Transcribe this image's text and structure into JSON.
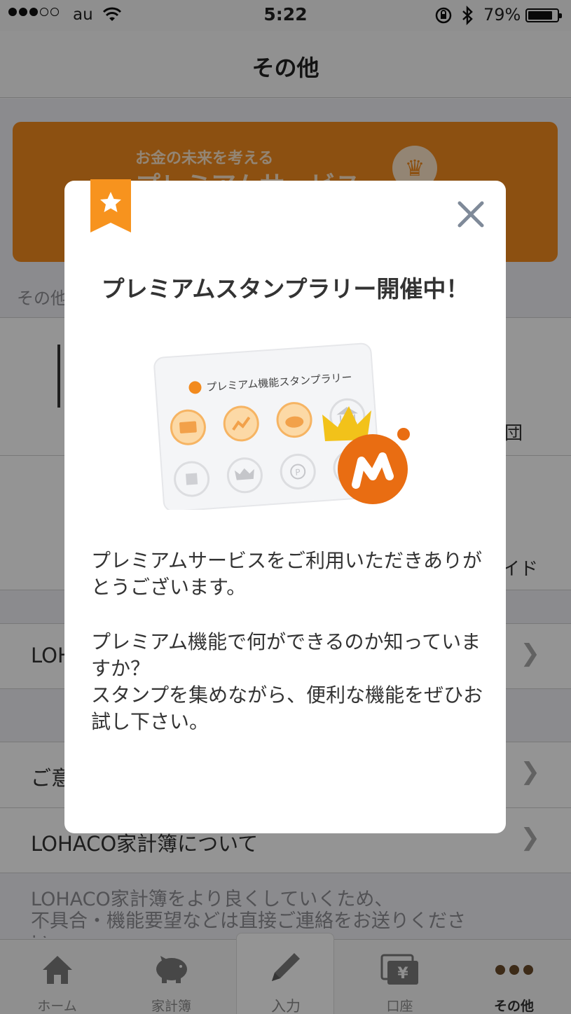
{
  "status_bar": {
    "carrier": "au",
    "time": "5:22",
    "battery": "79%"
  },
  "nav": {
    "title": "その他"
  },
  "banner": {
    "small_text": "お金の未来を考える",
    "big_text": "プレミアムサービス"
  },
  "background": {
    "section_label": "その他",
    "peek_dan": "団",
    "peek_ido": "イド",
    "row_lohaco_peek": "LOH",
    "row_feedback_peek": "ご意",
    "row_about": "LOHACO家計簿について",
    "footer_note": "LOHACO家計簿をより良くしていくため、\n不具合・機能要望などは直接ご連絡をお送りくださ\nい。"
  },
  "tabs": [
    {
      "label": "ホーム",
      "icon": "home-icon"
    },
    {
      "label": "家計簿",
      "icon": "piggy-bank-icon"
    },
    {
      "label": "入力",
      "icon": "pencil-icon"
    },
    {
      "label": "口座",
      "icon": "yen-card-icon"
    },
    {
      "label": "その他",
      "icon": "more-dots-icon"
    }
  ],
  "modal": {
    "title": "プレミアムスタンプラリー開催中！",
    "card_title": "プレミアム機能スタンプラリー",
    "paragraph1": "プレミアムサービスをご利用いただきありがとうございます。",
    "paragraph2": "プレミアム機能で何ができるのか知っていますか？\nスタンプを集めながら、便利な機能をぜひお試し下さい。"
  },
  "colors": {
    "accent_orange": "#f28a1e",
    "ribbon_orange": "#f7931e",
    "close_gray": "#7f8a99"
  }
}
